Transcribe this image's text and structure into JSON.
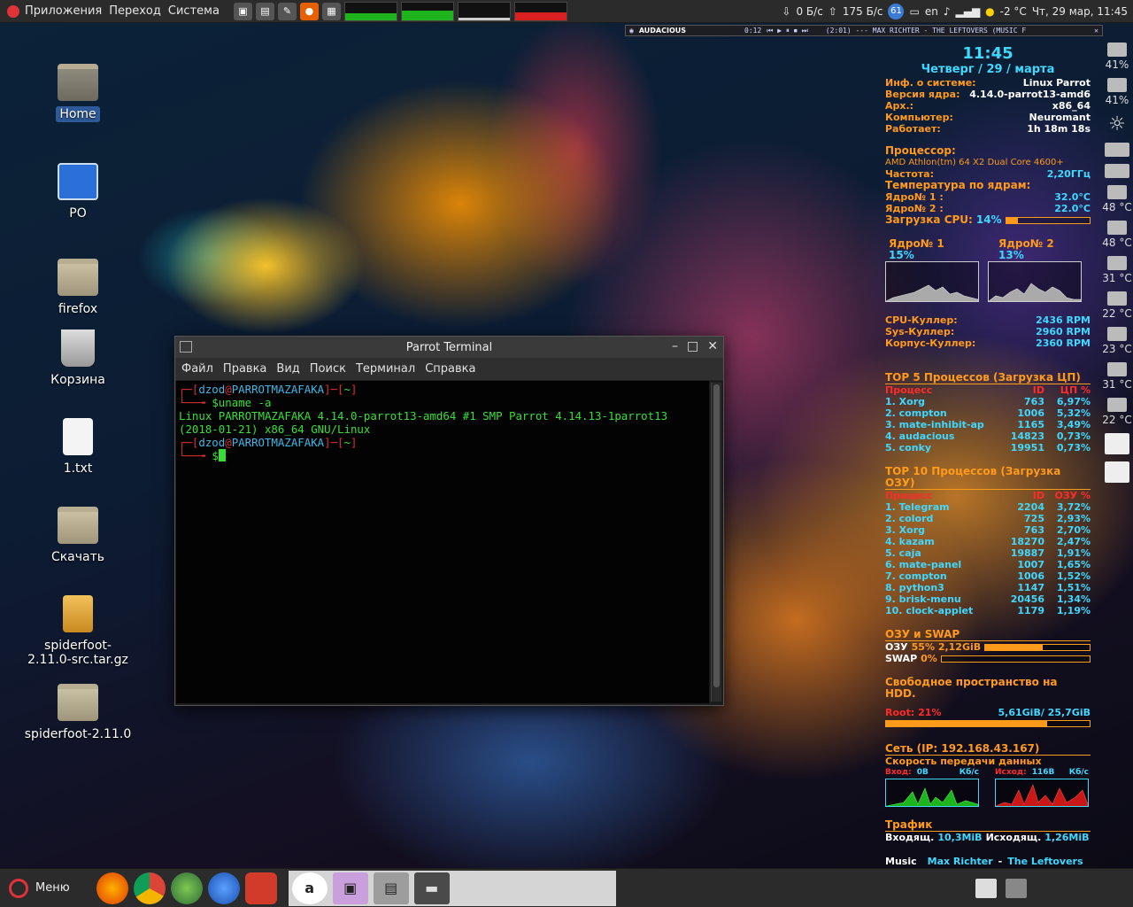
{
  "top_panel": {
    "menus": [
      "Приложения",
      "Переход",
      "Система"
    ],
    "launchers": [
      "▣",
      "▤",
      "✎",
      "●",
      "▦"
    ],
    "net_down": "0 Б/с",
    "net_up": "175 Б/с",
    "notifications": "61",
    "lang": "en",
    "weather": "-2 °C",
    "datetime": "Чт, 29 мар, 11:45"
  },
  "audacious": {
    "name": "AUDACIOUS",
    "time": "0:12",
    "track": "(2:01) --- MAX RICHTER - THE LEFTOVERS (MUSIC F"
  },
  "desktop": {
    "icons": [
      {
        "label": "Home"
      },
      {
        "label": "PO"
      },
      {
        "label": "firefox"
      },
      {
        "label": "Корзина"
      },
      {
        "label": "1.txt"
      },
      {
        "label": "Скачать"
      },
      {
        "label": "spiderfoot-2.11.0-src.tar.gz"
      },
      {
        "label": "spiderfoot-2.11.0"
      }
    ]
  },
  "terminal": {
    "title": "Parrot Terminal",
    "menu": [
      "Файл",
      "Правка",
      "Вид",
      "Поиск",
      "Терминал",
      "Справка"
    ],
    "user": "dzod",
    "host": "PARROTMAZAFAKA",
    "cwd": "~",
    "command": "uname -a",
    "output_line1": "Linux PARROTMAZAFAKA 4.14.0-parrot13-amd64 #1 SMP Parrot 4.14.13-1parrot13",
    "output_line2": "(2018-01-21) x86_64 GNU/Linux"
  },
  "conky": {
    "time": "11:45",
    "date": "Четверг / 29 / марта",
    "sys_info_label": "Инф. о системе:",
    "sys_info_value": "Linux Parrot",
    "kernel_label": "Версия ядра:",
    "kernel_value": "4.14.0-parrot13-amd6",
    "arch_label": "Арх.:",
    "arch_value": "x86_64",
    "computer_label": "Компьютер:",
    "computer_value": "Neuromant",
    "uptime_label": "Работает:",
    "uptime_value": "1h 18m 18s",
    "cpu_head": "Процессор:",
    "cpu_model": "AMD Athlon(tm) 64 X2 Dual Core 4600+",
    "freq_label": "Частота:",
    "freq_value": "2,20ГГц",
    "temp_head": "Температура по ядрам:",
    "core1_label": "Ядро№ 1 :",
    "core1_temp": "32.0°C",
    "core2_label": "Ядро№ 2 :",
    "core2_temp": "22.0°C",
    "cpu_load_label": "Загрузка CPU:",
    "cpu_load_value": "14%",
    "cpu_load_fraction": 0.14,
    "core1_name": "Ядро№ 1",
    "core1_pct": "15%",
    "core2_name": "Ядро№ 2",
    "core2_pct": "13%",
    "fans": [
      {
        "label": "CPU-Куллер:",
        "value": "2436 RPM"
      },
      {
        "label": "Sys-Куллер:",
        "value": "2960 RPM"
      },
      {
        "label": "Корпус-Куллер:",
        "value": "2360 RPM"
      }
    ],
    "top_cpu_head": "TOP 5 Процессов (Загрузка ЦП)",
    "top_cpu_cols": [
      "Процесс",
      "ID",
      "ЦП %"
    ],
    "top_cpu": [
      [
        "1. Xorg",
        "763",
        "6,97%"
      ],
      [
        "2. compton",
        "1006",
        "5,32%"
      ],
      [
        "3. mate-inhibit-ap",
        "1165",
        "3,49%"
      ],
      [
        "4. audacious",
        "14823",
        "0,73%"
      ],
      [
        "5. conky",
        "19951",
        "0,73%"
      ]
    ],
    "top_mem_head": "TOP 10 Процессов (Загрузка ОЗУ)",
    "top_mem_cols": [
      "Процесс",
      "ID",
      "ОЗУ %"
    ],
    "top_mem": [
      [
        "1. Telegram",
        "2204",
        "3,72%"
      ],
      [
        "2. colord",
        "725",
        "2,93%"
      ],
      [
        "3. Xorg",
        "763",
        "2,70%"
      ],
      [
        "4. kazam",
        "18270",
        "2,47%"
      ],
      [
        "5. caja",
        "19887",
        "1,91%"
      ],
      [
        "6. mate-panel",
        "1007",
        "1,65%"
      ],
      [
        "7. compton",
        "1006",
        "1,52%"
      ],
      [
        "8. python3",
        "1147",
        "1,51%"
      ],
      [
        "9. brisk-menu",
        "20456",
        "1,34%"
      ],
      [
        "10. clock-applet",
        "1179",
        "1,19%"
      ]
    ],
    "ram_head": "ОЗУ и SWAP",
    "ram_label": "ОЗУ",
    "ram_value": "55% 2,12GiB",
    "ram_fraction": 0.55,
    "swap_label": "SWAP",
    "swap_value": "0%",
    "swap_fraction": 0.0,
    "hdd_head": "Свободное пространство на HDD.",
    "root_label": "Root: 21%",
    "root_value": "5,61GiB/ 25,7GiB",
    "root_fraction": 0.79,
    "net_head": "Сеть (IP: 192.168.43.167)",
    "net_sub": "Скорость передачи данных",
    "net_in_label": "Вход:",
    "net_in_value": "0B",
    "net_in_unit": "Кб/с",
    "net_out_label": "Исход:",
    "net_out_value": "116B",
    "net_out_unit": "Кб/с",
    "traffic_head": "Трафик",
    "traffic_in_label": "Входящ.",
    "traffic_in_value": "10,3MiB",
    "traffic_out_label": "Исходящ.",
    "traffic_out_value": "1,26MiB",
    "music_label": "Music",
    "music_artist": "Max Richter",
    "music_sep": "-",
    "music_title": "The Leftovers"
  },
  "sensors": [
    "41%",
    "41%",
    "48 °C",
    "48 °C",
    "31 °C",
    "22 °C",
    "23 °C",
    "31 °C",
    "22 °C"
  ],
  "bottom_panel": {
    "menu_label": "Меню"
  },
  "colors": {
    "orange": "#ff9a1a",
    "cyan": "#3fd8ff",
    "terminal_green": "#35e035",
    "terminal_red": "#e03030"
  }
}
